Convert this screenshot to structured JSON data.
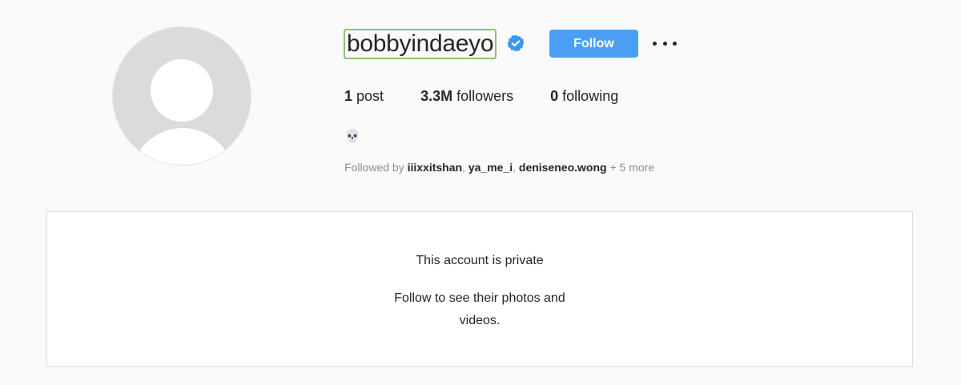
{
  "profile": {
    "username": "bobbyindaeyo",
    "verified_icon": "verified-badge-icon",
    "follow_label": "Follow",
    "more_icon": "more-options-icon",
    "stats": {
      "posts_count": "1",
      "posts_label": "post",
      "followers_count": "3.3M",
      "followers_label": "followers",
      "following_count": "0",
      "following_label": "following"
    },
    "bio": "💀",
    "followed_by": {
      "prefix": "Followed by ",
      "names": [
        "iiixxitshan",
        "ya_me_i",
        "deniseneo.wong"
      ],
      "suffix": " + 5 more"
    }
  },
  "private": {
    "title": "This account is private",
    "subtitle": "Follow to see their photos and videos."
  },
  "colors": {
    "accent": "#4a9ff5",
    "verified": "#3897f0",
    "highlight_border": "#8dc07a"
  }
}
